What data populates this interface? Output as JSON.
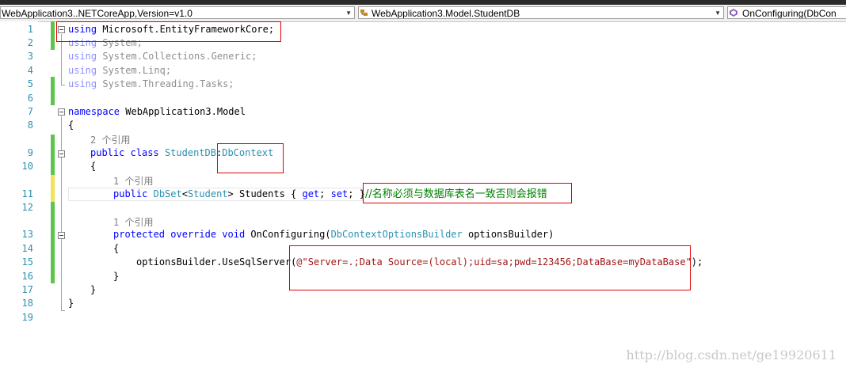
{
  "navbar": {
    "project_dropdown": "WebApplication3..NETCoreApp,Version=v1.0",
    "type_dropdown": "WebApplication3.Model.StudentDB",
    "member_dropdown": "OnConfiguring(DbCon"
  },
  "editor": {
    "line_numbers": [
      "1",
      "2",
      "3",
      "4",
      "5",
      "6",
      "7",
      "8",
      "9",
      "10",
      "11",
      "12",
      "13",
      "14",
      "15",
      "16",
      "17",
      "18",
      "19"
    ],
    "references": {
      "class_refs": "2 个引用",
      "prop_refs": "1 个引用",
      "method_refs": "1 个引用"
    },
    "lines": {
      "l1_kw": "using",
      "l1_rest": " Microsoft.EntityFrameworkCore;",
      "l2": "using System;",
      "l3": "using System.Collections.Generic;",
      "l4": "using System.Linq;",
      "l5": "using System.Threading.Tasks;",
      "l7_kw": "namespace",
      "l7_rest": " WebApplication3.Model",
      "l8": "{",
      "l9_kw1": "public",
      "l9_kw2": "class",
      "l9_type": "StudentDB",
      "l9_colon": ":",
      "l9_base": "DbContext",
      "l10": "{",
      "l11_kw": "public",
      "l11_type": "DbSet",
      "l11_lt": "<",
      "l11_gen": "Student",
      "l11_gt": ">",
      "l11_name": " Students { ",
      "l11_get": "get",
      "l11_semi1": "; ",
      "l11_set": "set",
      "l11_semi2": "; }",
      "l11_comment": "//名称必须与数据库表名一致否则会报错",
      "l13_kw1": "protected",
      "l13_kw2": "override",
      "l13_kw3": "void",
      "l13_name": " OnConfiguring(",
      "l13_type": "DbContextOptionsBuilder",
      "l13_param": " optionsBuilder)",
      "l14": "{",
      "l15_call": "optionsBuilder.UseSqlServer(",
      "l15_str": "@\"Server=.;Data Source=(local);uid=sa;pwd=123456;DataBase=myDataBase\"",
      "l15_end": ");",
      "l16": "}",
      "l17": "}",
      "l18": "}"
    }
  },
  "watermark": "http://blog.csdn.net/ge19920611"
}
